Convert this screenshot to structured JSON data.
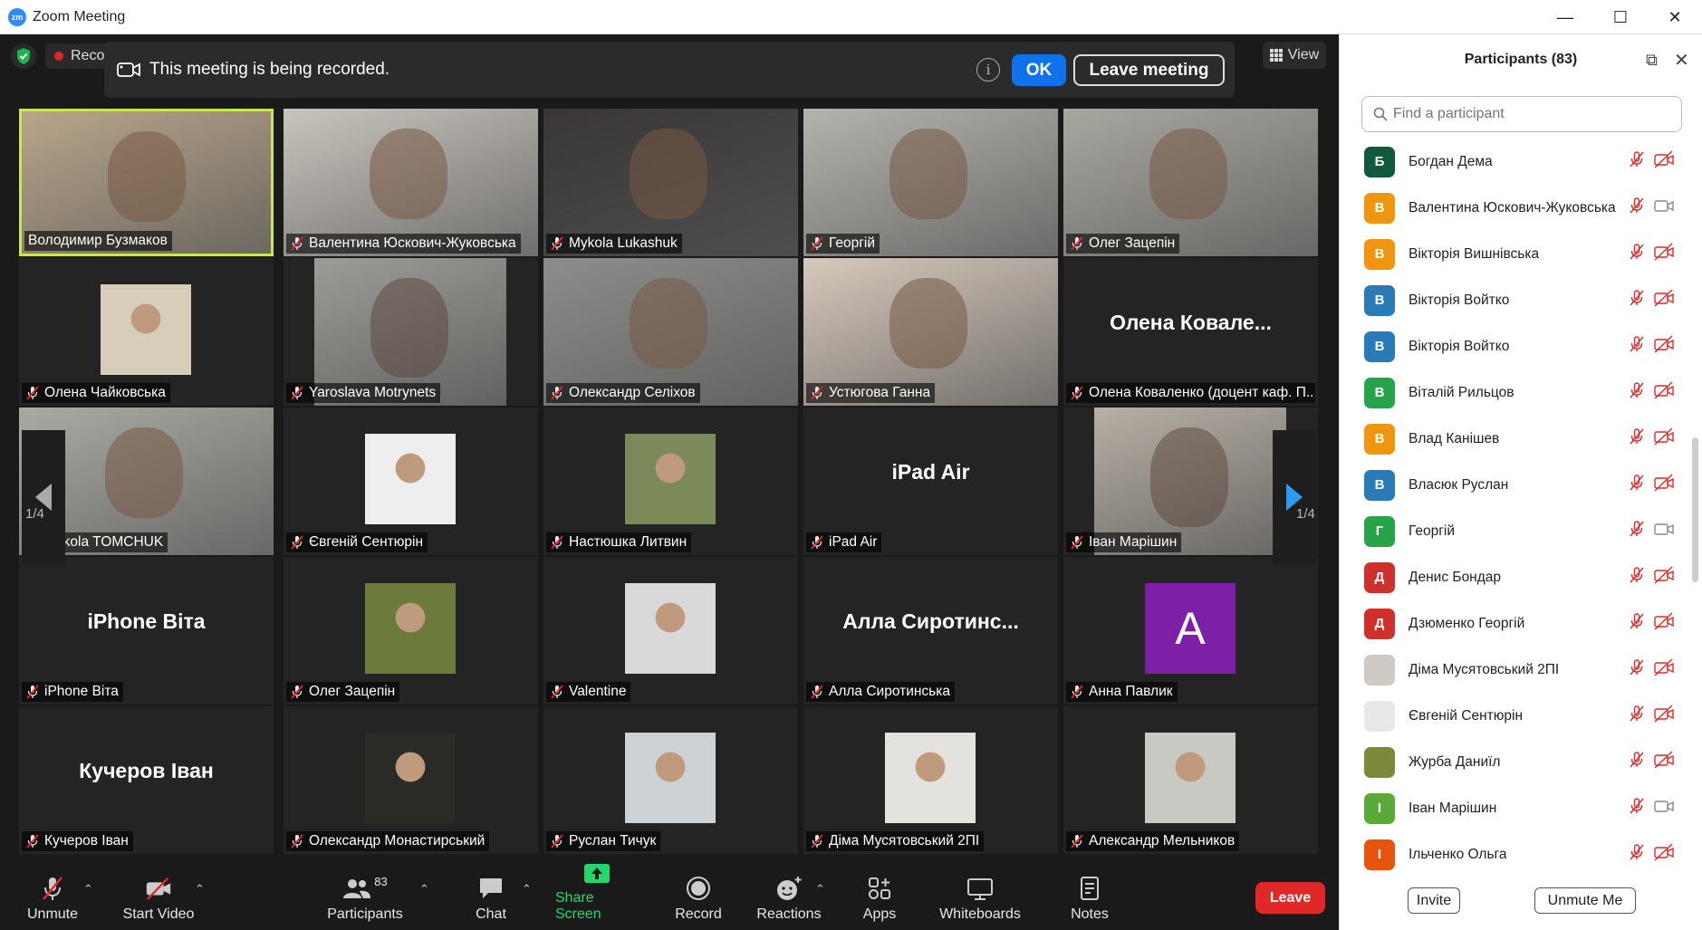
{
  "window": {
    "title": "Zoom Meeting",
    "minimize": "—",
    "maximize": "☐",
    "close": "✕"
  },
  "status": {
    "recording_label": "Reco"
  },
  "banner": {
    "message": "This meeting is being recorded.",
    "info_label": "i",
    "ok_label": "OK",
    "leave_label": "Leave meeting"
  },
  "view_label": "View",
  "page": {
    "left": "1/4",
    "right": "1/4"
  },
  "tiles": [
    {
      "name": "Володимир Бузмаков",
      "kind": "video",
      "bg": "#b9a58a",
      "active": true
    },
    {
      "name": "Валентина Юскович-Жуковська",
      "kind": "video",
      "bg": "#c9c4bd"
    },
    {
      "name": "Mykola Lukashuk",
      "kind": "video",
      "bg": "#3a3636"
    },
    {
      "name": "Георгій",
      "kind": "video",
      "bg": "#b5b3ad"
    },
    {
      "name": "Олег Зацепін",
      "kind": "video",
      "bg": "#a8a7a0"
    },
    {
      "name": "Олена Чайковська",
      "kind": "photo",
      "bg": "#d8cdb8"
    },
    {
      "name": "Yaroslava Motrynets",
      "kind": "videonarrow",
      "bg": "#9d9c97"
    },
    {
      "name": "Олександр Селіхов",
      "kind": "video",
      "bg": "#8c8e8b"
    },
    {
      "name": "Устюгова Ганна",
      "kind": "video",
      "bg": "#d7c9bc"
    },
    {
      "name": "Олена  Коваленко (доцент каф. П...",
      "kind": "text",
      "big": "Олена  Ковале..."
    },
    {
      "name": "Mykola TOMCHUK",
      "kind": "video",
      "bg": "#a9aba3"
    },
    {
      "name": "Євгеній Сентюрін",
      "kind": "photo",
      "bg": "#eeeeee"
    },
    {
      "name": "Настюшка Литвин",
      "kind": "photo",
      "bg": "#7c8a5a"
    },
    {
      "name": "iPad Air",
      "kind": "text",
      "big": "iPad Air"
    },
    {
      "name": "Іван Марішин",
      "kind": "videonarrow",
      "bg": "#b7b0a6"
    },
    {
      "name": "iPhone Віта",
      "kind": "text",
      "big": "iPhone Віта"
    },
    {
      "name": "Олег Зацепін",
      "kind": "photo",
      "bg": "#6c7a3a"
    },
    {
      "name": "Valentine",
      "kind": "photo",
      "bg": "#d9d9d9"
    },
    {
      "name": "Алла Сиротинська",
      "kind": "text",
      "big": "Алла  Сиротинс..."
    },
    {
      "name": "Анна Павлик",
      "kind": "letter",
      "letter": "A",
      "bg": "#7e1fa8"
    },
    {
      "name": "Кучеров Іван",
      "kind": "text",
      "big": "Кучеров Іван"
    },
    {
      "name": "Олександр Монастирський",
      "kind": "photo",
      "bg": "#2a2a26"
    },
    {
      "name": "Руслан Тичук",
      "kind": "photo",
      "bg": "#cfd2d4"
    },
    {
      "name": "Діма Мусятовський 2ПІ",
      "kind": "photo",
      "bg": "#e4e2de"
    },
    {
      "name": "Александр Мельников",
      "kind": "photo",
      "bg": "#c7c9c2"
    }
  ],
  "toolbar": {
    "unmute": "Unmute",
    "start_video": "Start Video",
    "participants": "Participants",
    "participants_count": "83",
    "chat": "Chat",
    "share_screen": "Share Screen",
    "record": "Record",
    "reactions": "Reactions",
    "apps": "Apps",
    "whiteboards": "Whiteboards",
    "notes": "Notes",
    "leave": "Leave"
  },
  "panel": {
    "title": "Participants (83)",
    "search_placeholder": "Find a participant",
    "invite": "Invite",
    "unmute_me": "Unmute Me",
    "participants": [
      {
        "name": "Богдан Дема",
        "initial": "Б",
        "color": "#0f5a3c",
        "video": "off"
      },
      {
        "name": "Валентина Юскович-Жуковська",
        "initial": "В",
        "color": "#f0960e",
        "video": "on"
      },
      {
        "name": "Вікторія Вишнівська",
        "initial": "В",
        "color": "#f0960e",
        "video": "off"
      },
      {
        "name": "Вікторія Войтко",
        "initial": "В",
        "color": "#2a7ab8",
        "video": "off"
      },
      {
        "name": "Вікторія Войтко",
        "initial": "В",
        "color": "#2a7ab8",
        "video": "off"
      },
      {
        "name": "Віталій Рильцов",
        "initial": "В",
        "color": "#27a44a",
        "video": "off"
      },
      {
        "name": "Влад Канішев",
        "initial": "В",
        "color": "#f0960e",
        "video": "off"
      },
      {
        "name": "Власюк Руслан",
        "initial": "В",
        "color": "#2a7ab8",
        "video": "off"
      },
      {
        "name": "Георгій",
        "initial": "Г",
        "color": "#27a44a",
        "video": "on"
      },
      {
        "name": "Денис Бондар",
        "initial": "Д",
        "color": "#d0302c",
        "video": "off"
      },
      {
        "name": "Дзюменко Георгій",
        "initial": "Д",
        "color": "#d0302c",
        "video": "off"
      },
      {
        "name": "Діма Мусятовський 2ПІ",
        "initial": "",
        "color": "#cfcac4",
        "video": "off"
      },
      {
        "name": "Євгеній Сентюрін",
        "initial": "",
        "color": "#e8e8e8",
        "video": "off"
      },
      {
        "name": "Журба Даниїл",
        "initial": "",
        "color": "#7a8a3a",
        "video": "off"
      },
      {
        "name": "Іван Марішин",
        "initial": "І",
        "color": "#5aaa3a",
        "video": "on"
      },
      {
        "name": "Ільченко Ольга",
        "initial": "І",
        "color": "#e8540c",
        "video": "off"
      }
    ]
  }
}
